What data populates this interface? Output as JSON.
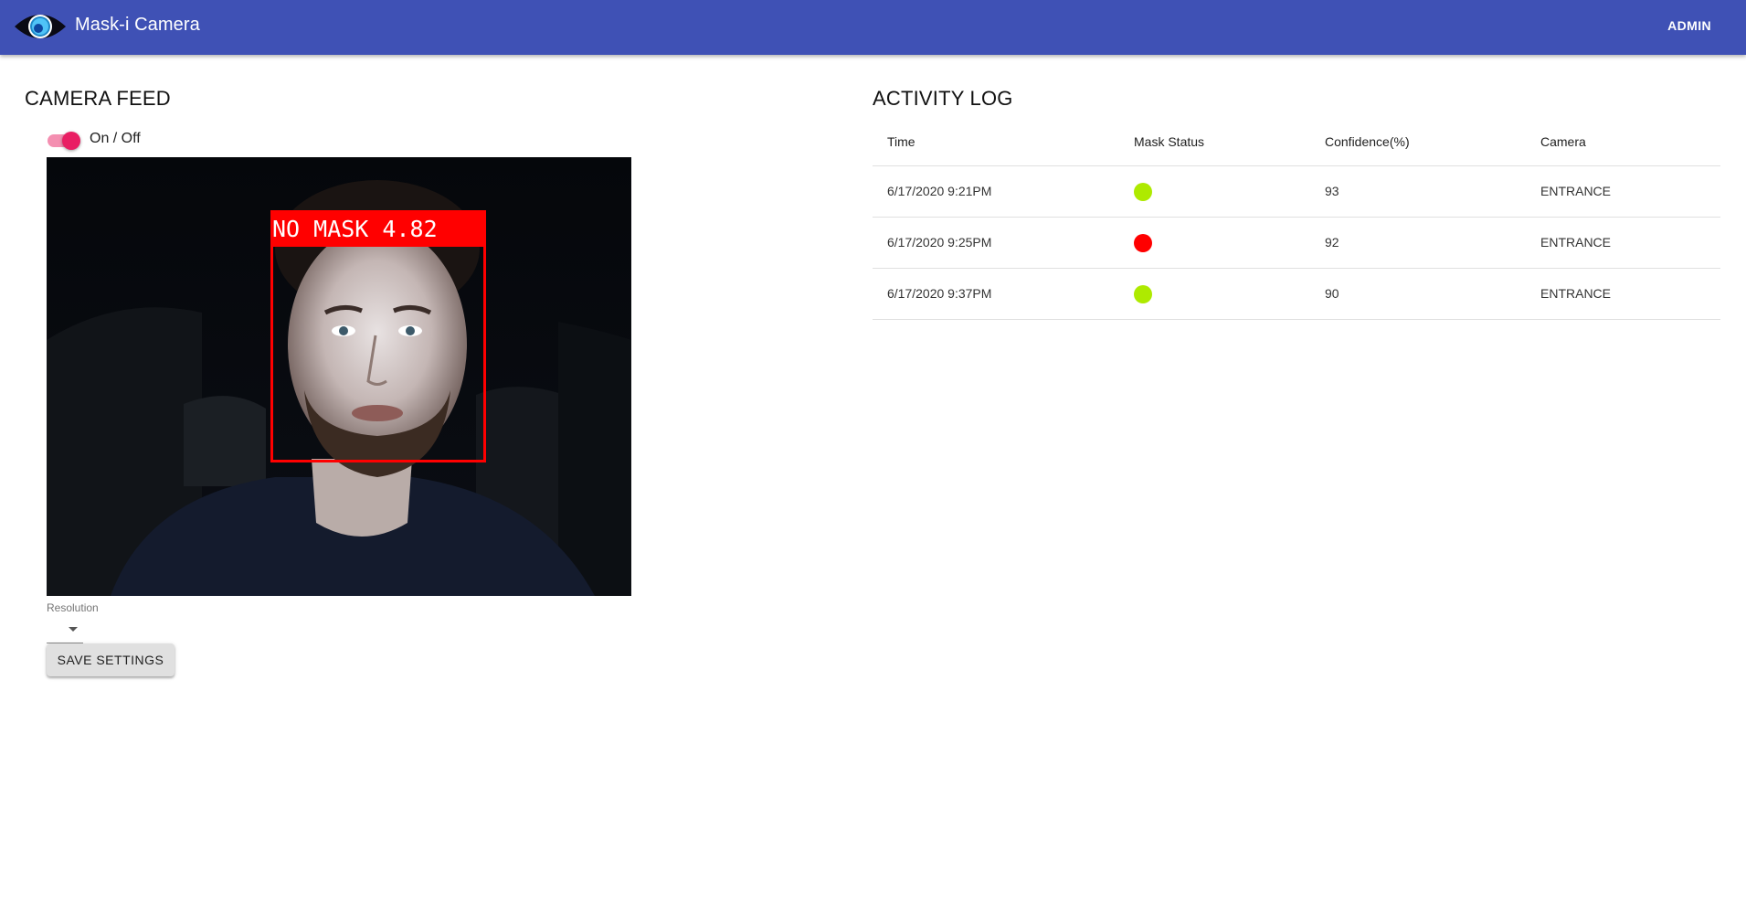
{
  "app": {
    "title": "Mask-i Camera",
    "account_label": "ADMIN",
    "logo_icon": "eye-icon",
    "bar_color": "#3f51b5"
  },
  "camera": {
    "section_title": "CAMERA FEED",
    "toggle": {
      "label": "On / Off",
      "on": true,
      "color": "#e91e63"
    },
    "feed": {
      "detection_label": "NO MASK 4.82",
      "detection_color": "#ff0000"
    },
    "resolution": {
      "label": "Resolution",
      "value": ""
    },
    "save_label": "SAVE SETTINGS"
  },
  "activity_log": {
    "section_title": "ACTIVITY LOG",
    "columns": [
      "Time",
      "Mask Status",
      "Confidence(%)",
      "Camera"
    ],
    "rows": [
      {
        "time": "6/17/2020 9:21PM",
        "mask_status": "mask",
        "status_color": "#aeea00",
        "confidence": "93",
        "camera": "ENTRANCE"
      },
      {
        "time": "6/17/2020 9:25PM",
        "mask_status": "no-mask",
        "status_color": "#ff0000",
        "confidence": "92",
        "camera": "ENTRANCE"
      },
      {
        "time": "6/17/2020 9:37PM",
        "mask_status": "mask",
        "status_color": "#aeea00",
        "confidence": "90",
        "camera": "ENTRANCE"
      }
    ]
  }
}
